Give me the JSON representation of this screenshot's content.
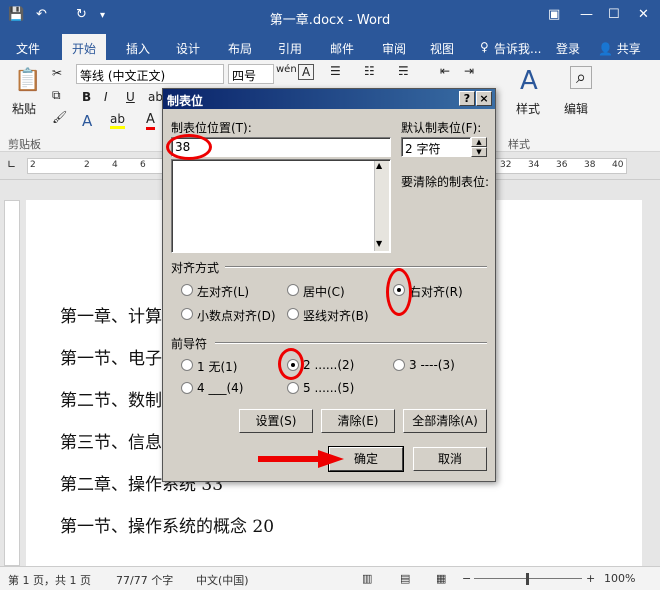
{
  "window": {
    "title": "第一章.docx - Word"
  },
  "menu": {
    "items": [
      "文件",
      "开始",
      "插入",
      "设计",
      "布局",
      "引用",
      "邮件",
      "审阅",
      "视图"
    ],
    "tellme": "告诉我...",
    "login": "登录",
    "share": "共享"
  },
  "ribbon": {
    "paste_label": "粘贴",
    "clipboard_label": "剪贴板",
    "font_name": "等线 (中文正文)",
    "font_size": "四号",
    "styles_label": "样式",
    "edit_label": "编辑",
    "styles_group": "样式"
  },
  "ruler": {
    "left": [
      "2",
      "2",
      "4",
      "6"
    ],
    "right": [
      "32",
      "34",
      "36",
      "38",
      "40"
    ]
  },
  "document": {
    "lines": [
      "第一章、计算",
      "第一节、电子",
      "第二节、数制",
      "第三节、信息",
      "第二章、操作系统  33",
      "第一节、操作系统的概念   20"
    ]
  },
  "dialog": {
    "title": "制表位",
    "tab_position_label": "制表位位置(T):",
    "tab_position_value": "38",
    "default_tab_label": "默认制表位(F):",
    "default_tab_value": "2 字符",
    "clear_label": "要清除的制表位:",
    "alignment_label": "对齐方式",
    "alignment_options": [
      "左对齐(L)",
      "居中(C)",
      "右对齐(R)",
      "小数点对齐(D)",
      "竖线对齐(B)"
    ],
    "alignment_selected": "右对齐(R)",
    "leader_label": "前导符",
    "leader_options": [
      "1 无(1)",
      "2 ......(2)",
      "3 ----(3)",
      "4 ___(4)",
      "5 ......(5)"
    ],
    "leader_selected": "2 ......(2)",
    "btn_set": "设置(S)",
    "btn_clear": "清除(E)",
    "btn_clear_all": "全部清除(A)",
    "btn_ok": "确定",
    "btn_cancel": "取消",
    "help_glyph": "?",
    "close_glyph": "×"
  },
  "status": {
    "page": "第 1 页，共 1 页",
    "words": "77/77 个字",
    "lang": "中文(中国)",
    "zoom": "100%"
  },
  "colors": {
    "accent": "#2b579a",
    "highlight": "#e00000"
  }
}
